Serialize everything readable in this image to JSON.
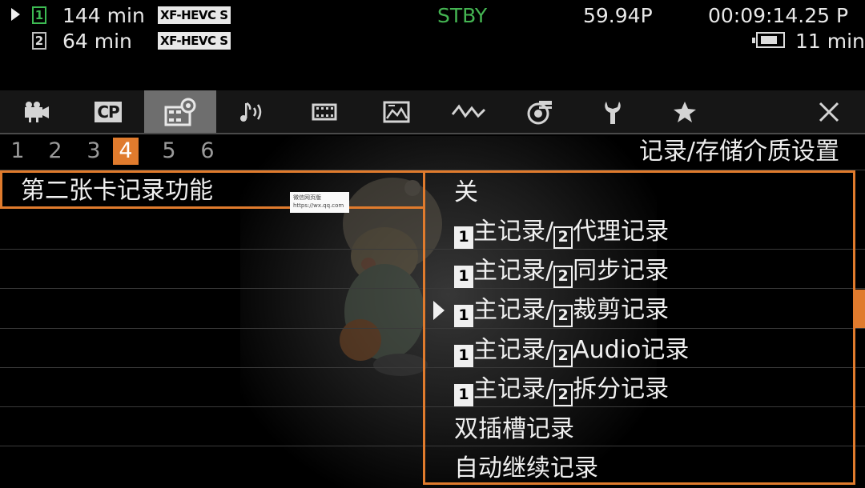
{
  "status": {
    "slot1_label": "1",
    "slot1_time": "144 min",
    "slot1_codec": "XF-HEVC S",
    "slot2_label": "2",
    "slot2_time": "64 min",
    "slot2_codec": "XF-HEVC S",
    "mode": "STBY",
    "frame_rate": "59.94P",
    "timecode": "00:09:14.25 P",
    "battery_time": "11 min",
    "colors": {
      "slot1": "#3dbb53",
      "stby": "#44b552"
    }
  },
  "tabs": [
    {
      "icon": "camera-icon"
    },
    {
      "icon": "cp-icon",
      "label": "CP"
    },
    {
      "icon": "recording-setup-icon",
      "active": true
    },
    {
      "icon": "audio-icon"
    },
    {
      "icon": "film-icon"
    },
    {
      "icon": "image-assist-icon"
    },
    {
      "icon": "waveform-icon"
    },
    {
      "icon": "monitoring-icon"
    },
    {
      "icon": "wrench-icon"
    },
    {
      "icon": "star-icon"
    },
    {
      "icon": "close-icon"
    }
  ],
  "pages": [
    "1",
    "2",
    "3",
    "4",
    "5",
    "6"
  ],
  "active_page": "4",
  "menu_title": "记录/存储介质设置",
  "current_item": {
    "label": "第二张卡记录功能"
  },
  "options": [
    {
      "parts": [
        "关"
      ]
    },
    {
      "slot1": "1",
      "text1": "主记录/",
      "slot2": "2",
      "text2": "代理记录"
    },
    {
      "slot1": "1",
      "text1": "主记录/",
      "slot2": "2",
      "text2": "同步记录"
    },
    {
      "slot1": "1",
      "text1": "主记录/",
      "slot2": "2",
      "text2": "裁剪记录",
      "selected": true
    },
    {
      "slot1": "1",
      "text1": "主记录/",
      "slot2": "2",
      "text2": "Audio记录"
    },
    {
      "slot1": "1",
      "text1": "主记录/",
      "slot2": "2",
      "text2": "拆分记录"
    },
    {
      "parts": [
        "双插槽记录"
      ]
    },
    {
      "parts": [
        "自动继续记录"
      ]
    }
  ],
  "popup": {
    "line1": "微信网页版",
    "line2": "https://wx.qq.com"
  },
  "accent": "#e07b2d"
}
